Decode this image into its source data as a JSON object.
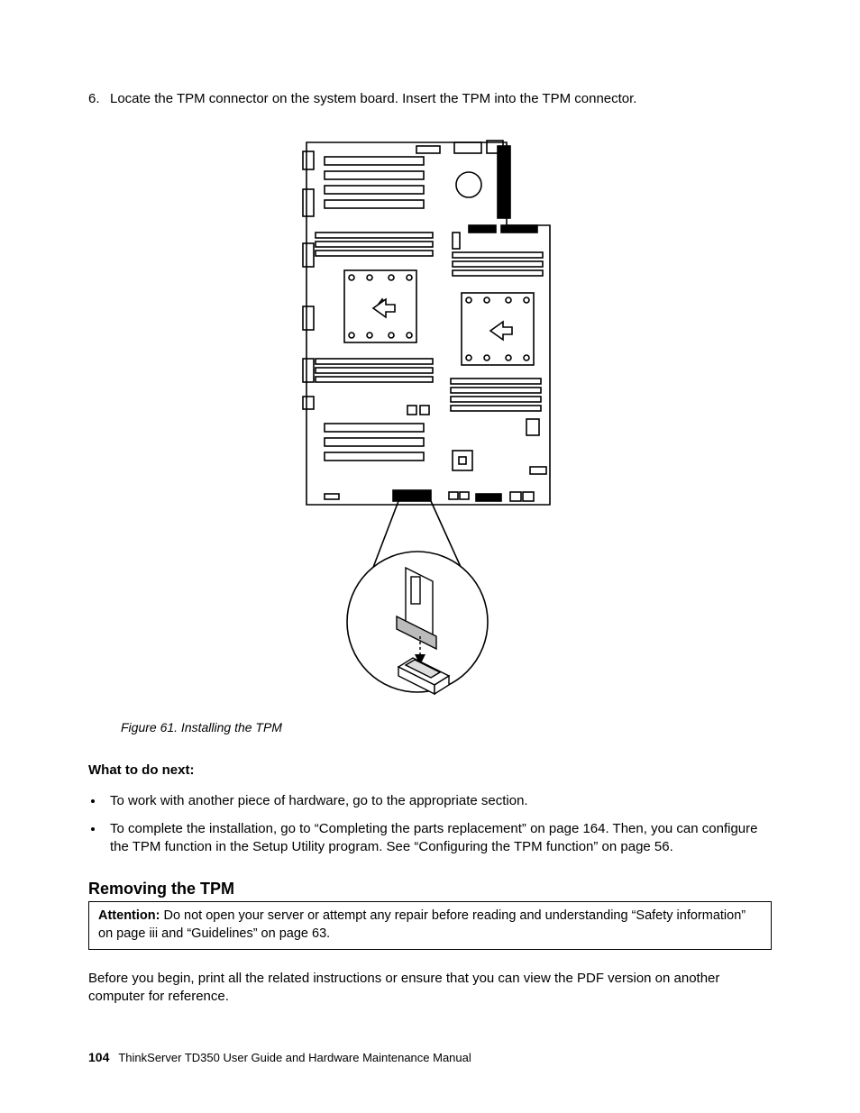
{
  "step": {
    "number": "6.",
    "text": "Locate the TPM connector on the system board. Insert the TPM into the TPM connector."
  },
  "figure": {
    "caption": "Figure 61.  Installing the TPM"
  },
  "next": {
    "heading": "What to do next:",
    "bullets": [
      "To work with another piece of hardware, go to the appropriate section.",
      "To complete the installation, go to “Completing the parts replacement” on page 164. Then, you can configure the TPM function in the Setup Utility program. See “Configuring the TPM function” on page 56."
    ]
  },
  "section": {
    "title": "Removing the TPM",
    "attention_label": "Attention:",
    "attention_text": " Do not open your server or attempt any repair before reading and understanding “Safety information” on page iii and “Guidelines” on page 63.",
    "intro": "Before you begin, print all the related instructions or ensure that you can view the PDF version on another computer for reference."
  },
  "footer": {
    "page": "104",
    "title": "ThinkServer TD350 User Guide and Hardware Maintenance Manual"
  }
}
